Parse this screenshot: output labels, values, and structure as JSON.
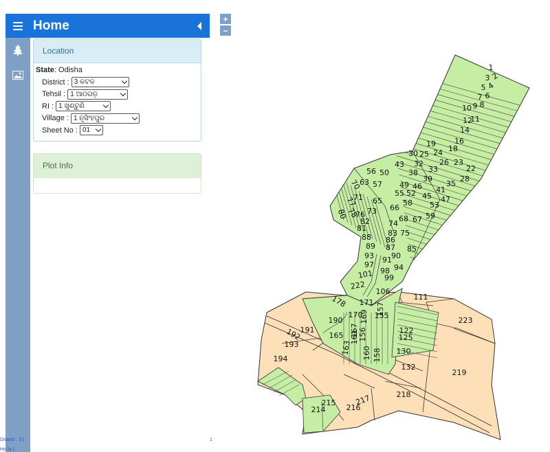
{
  "header": {
    "title": "Home"
  },
  "location_panel": {
    "title": "Location",
    "state_label": "State",
    "state_value": "Odisha",
    "fields": {
      "district": {
        "label": "District :",
        "value": "3 କଟକ"
      },
      "tehsil": {
        "label": "Tehsil :",
        "value": "1 ଆଠଗଡ଼"
      },
      "ri": {
        "label": "RI :",
        "value": "1 ଖୁଣ୍ଟୁଣି"
      },
      "village": {
        "label": "Village :",
        "value": "1 ନୃସିଂହପୁର"
      },
      "sheet": {
        "label": "Sheet No  :",
        "value": "01"
      }
    }
  },
  "plot_panel": {
    "title": "Plot Info"
  },
  "zoom": {
    "in": "+",
    "out": "−"
  },
  "status": {
    "left": "District : 3 |",
    "right": "1",
    "second": "Ho  |a |"
  },
  "colors": {
    "header": "#1a73d9",
    "rail": "#7fa0c5",
    "plot_green": "#c5eea4",
    "plot_tan": "#fde0b8",
    "stroke": "#333333"
  },
  "icons": {
    "menu": "menu-icon",
    "collapse": "collapse-arrow-icon",
    "tree": "tree-icon",
    "image": "image-icon"
  },
  "plot_numbers": [
    "1",
    "2",
    "3",
    "4",
    "5",
    "6",
    "7",
    "8",
    "9",
    "10",
    "11",
    "12",
    "14",
    "16",
    "18",
    "19",
    "22",
    "23",
    "24",
    "25",
    "26",
    "28",
    "30",
    "32",
    "33",
    "35",
    "38",
    "39",
    "41",
    "43",
    "45",
    "46",
    "47",
    "49",
    "50",
    "52",
    "53",
    "55",
    "56",
    "57",
    "58",
    "59",
    "63",
    "65",
    "66",
    "67",
    "68",
    "70",
    "71",
    "73",
    "74",
    "75",
    "76",
    "77",
    "78",
    "80",
    "81",
    "82",
    "83",
    "85",
    "86",
    "87",
    "88",
    "89",
    "90",
    "91",
    "93",
    "94",
    "97",
    "98",
    "99",
    "101",
    "106",
    "111",
    "122",
    "125",
    "130",
    "132",
    "155",
    "156",
    "157",
    "158",
    "160",
    "161",
    "163",
    "165",
    "167",
    "169",
    "170",
    "171",
    "178",
    "190",
    "191",
    "192",
    "193",
    "194",
    "214",
    "215",
    "216",
    "217",
    "218",
    "219",
    "222",
    "223"
  ]
}
